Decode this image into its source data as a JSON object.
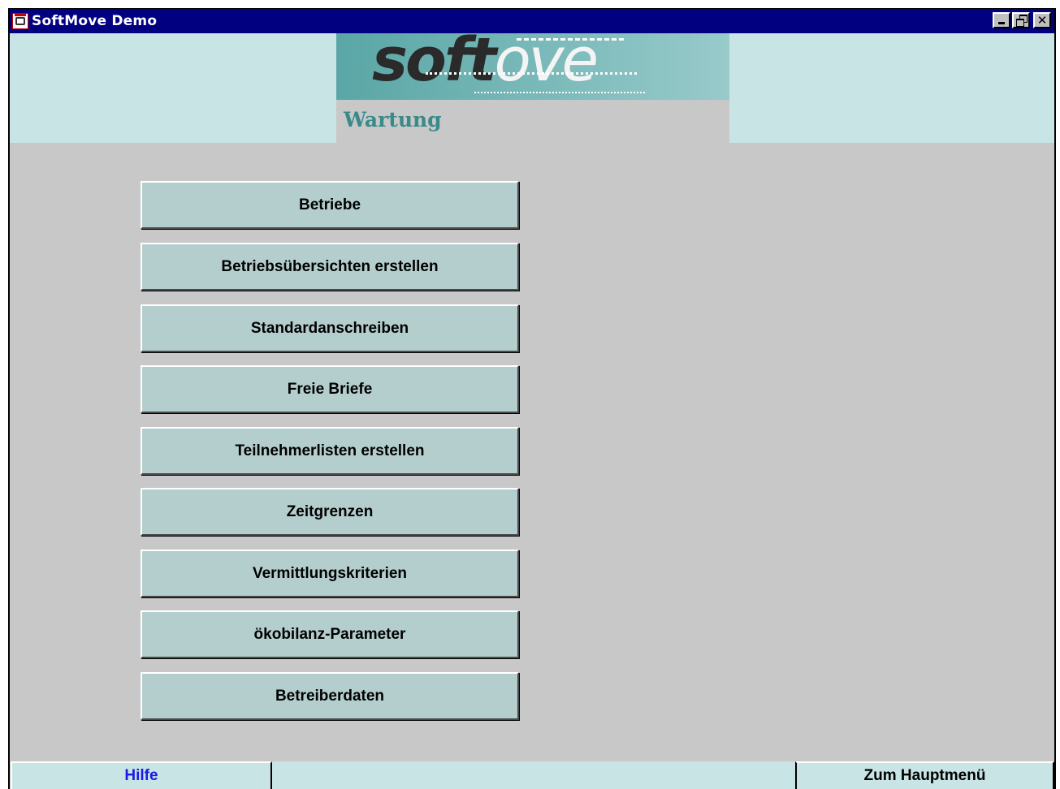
{
  "window": {
    "title": "SoftMove Demo"
  },
  "header": {
    "logo_text_dark": "soft",
    "logo_text_light": "ove",
    "subtitle": "Wartung"
  },
  "menu": {
    "buttons": [
      "Betriebe",
      "Betriebsübersichten erstellen",
      "Standardanschreiben",
      "Freie Briefe",
      "Teilnehmerlisten erstellen",
      "Zeitgrenzen",
      "Vermittlungskriterien",
      "ökobilanz-Parameter",
      "Betreiberdaten"
    ]
  },
  "footer": {
    "help_label": "Hilfe",
    "main_menu_label": "Zum Hauptmenü"
  },
  "colors": {
    "titlebar": "#000080",
    "header_bg": "#c8e4e4",
    "button_bg": "#b4cece",
    "help_text": "#1a1ae6",
    "subtitle_text": "#3a8a8a"
  },
  "icons": [
    "app-icon",
    "minimize-icon",
    "restore-icon",
    "close-icon"
  ]
}
